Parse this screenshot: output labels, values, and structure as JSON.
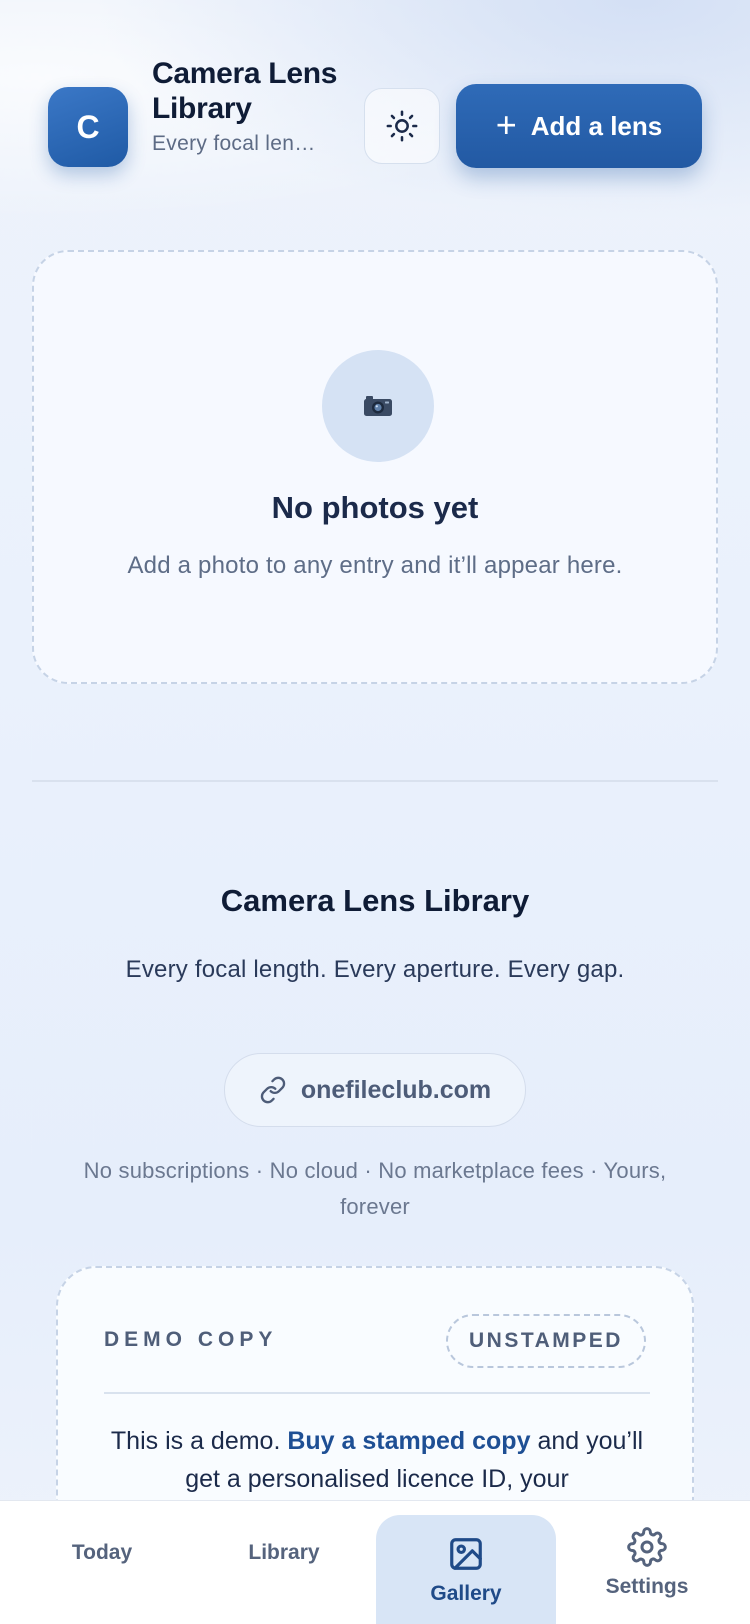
{
  "header": {
    "avatar_letter": "C",
    "title": "Camera Lens Library",
    "subtitle": "Every focal len…",
    "theme_icon": "sun-icon",
    "add_button": {
      "icon": "plus-icon",
      "label": "Add a lens"
    }
  },
  "gallery_empty": {
    "icon": "camera-icon",
    "title": "No photos yet",
    "text": "Add a photo to any entry and it’ll appear here."
  },
  "footer": {
    "title": "Camera Lens Library",
    "tagline": "Every focal length. Every aperture. Every gap.",
    "link": {
      "icon": "link-icon",
      "label": "onefileclub.com"
    },
    "note": "No subscriptions · No cloud · No marketplace fees · Yours, forever"
  },
  "demo": {
    "label": "DEMO COPY",
    "badge": "UNSTAMPED",
    "text_before": "This is a demo.",
    "text_link": "Buy a stamped copy",
    "text_after": "and you’ll get a personalised licence ID, your"
  },
  "tabs": [
    {
      "label": "Today",
      "icon": "",
      "active": false
    },
    {
      "label": "Library",
      "icon": "",
      "active": false
    },
    {
      "label": "Gallery",
      "icon": "image-icon",
      "active": true
    },
    {
      "label": "Settings",
      "icon": "gear-icon",
      "active": false
    }
  ],
  "colors": {
    "accent": "#2259a3",
    "active_tab_bg": "#d8e5f6",
    "text_primary": "#0f1c36",
    "text_muted": "#5e6d87"
  }
}
